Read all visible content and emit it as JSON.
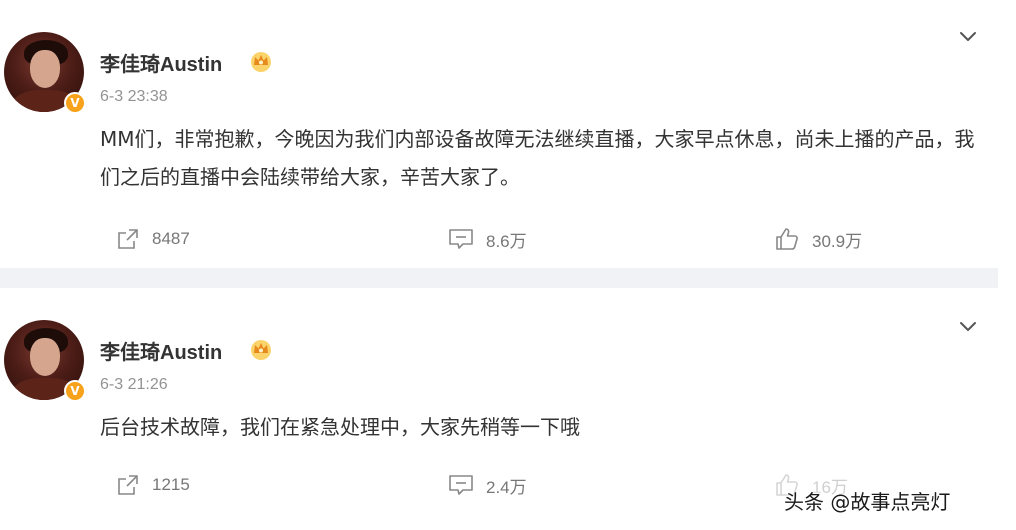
{
  "posts": [
    {
      "username": "李佳琦Austin",
      "timestamp": "6-3 23:38",
      "content": "MM们，非常抱歉，今晚因为我们内部设备故障无法继续直播，大家早点休息，尚未上播的产品，我们之后的直播中会陆续带给大家，辛苦大家了。",
      "verified_mark": "V",
      "reposts": "8487",
      "comments": "8.6万",
      "likes": "30.9万"
    },
    {
      "username": "李佳琦Austin",
      "timestamp": "6-3 21:26",
      "content": "后台技术故障，我们在紧急处理中，大家先稍等一下哦",
      "verified_mark": "V",
      "reposts": "1215",
      "comments": "2.4万",
      "likes": "16万"
    }
  ],
  "watermark": "头条 @故事点亮灯",
  "colors": {
    "verified_badge": "#f7a21a",
    "crown": "#f5a623",
    "divider": "#f1f2f5",
    "meta_text": "#939393"
  },
  "icons": {
    "share": "share-icon",
    "comment": "comment-icon",
    "like": "thumbs-up-icon",
    "more": "chevron-down-icon",
    "member": "crown-icon"
  }
}
